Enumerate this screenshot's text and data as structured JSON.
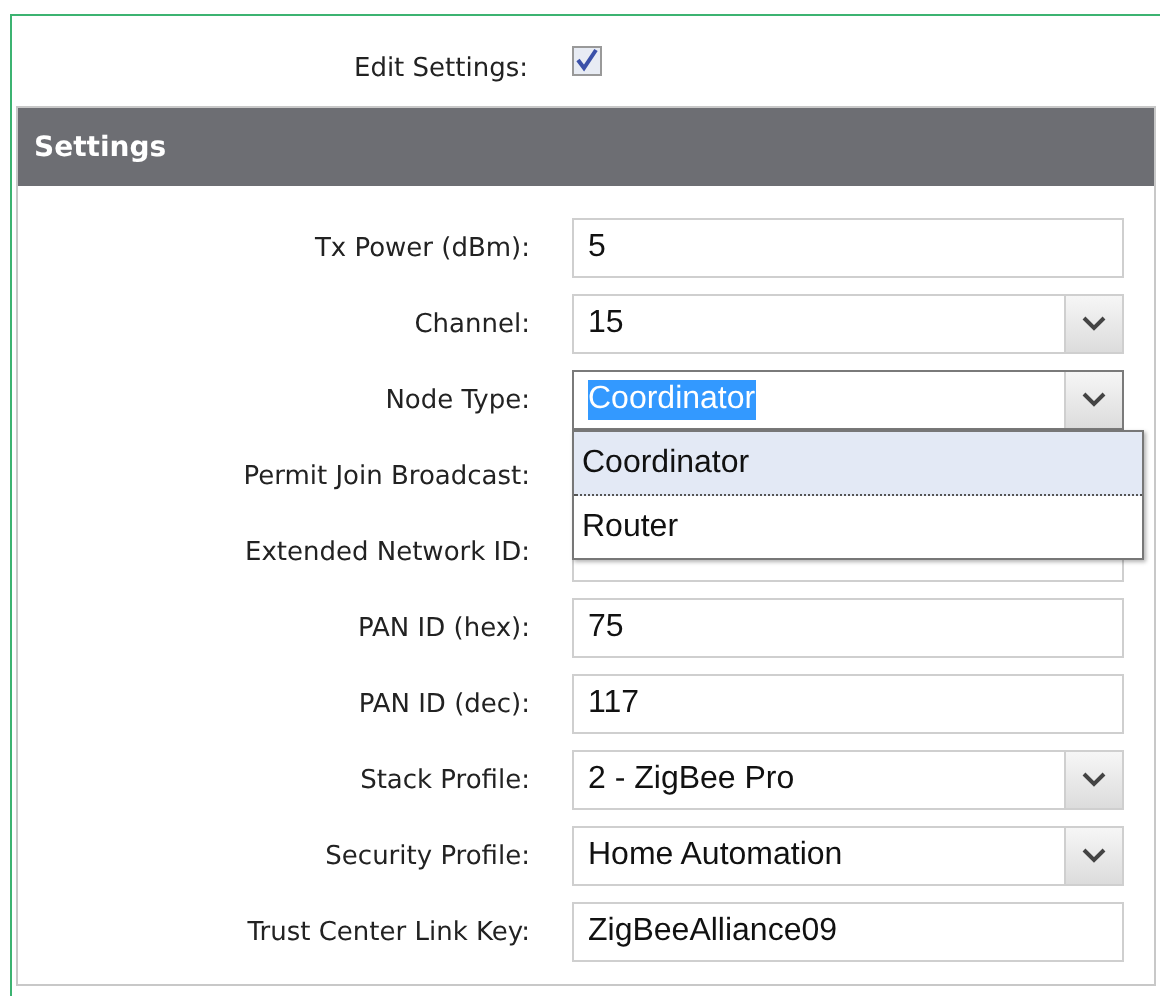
{
  "edit_settings": {
    "label": "Edit Settings:",
    "checked": true
  },
  "section": {
    "title": "Settings"
  },
  "fields": [
    {
      "label": "Tx Power (dBm):",
      "kind": "text",
      "value": "5"
    },
    {
      "label": "Channel:",
      "kind": "select",
      "value": "15"
    },
    {
      "label": "Node Type:",
      "kind": "select",
      "value": "Coordinator",
      "focused": true,
      "expanded": true,
      "options": [
        {
          "label": "Coordinator",
          "selected": true
        },
        {
          "label": "Router",
          "selected": false
        }
      ]
    },
    {
      "label": "Permit Join Broadcast:",
      "kind": "covered"
    },
    {
      "label": "Extended Network ID:",
      "kind": "text"
    },
    {
      "label": "PAN ID (hex):",
      "kind": "text",
      "value": "75"
    },
    {
      "label": "PAN ID (dec):",
      "kind": "text",
      "value": "117"
    },
    {
      "label": "Stack Profile:",
      "kind": "select",
      "value": "2 - ZigBee Pro"
    },
    {
      "label": "Security Profile:",
      "kind": "select",
      "value": "Home Automation"
    },
    {
      "label": "Trust Center Link Key:",
      "kind": "text",
      "value": "ZigBeeAlliance09"
    }
  ]
}
